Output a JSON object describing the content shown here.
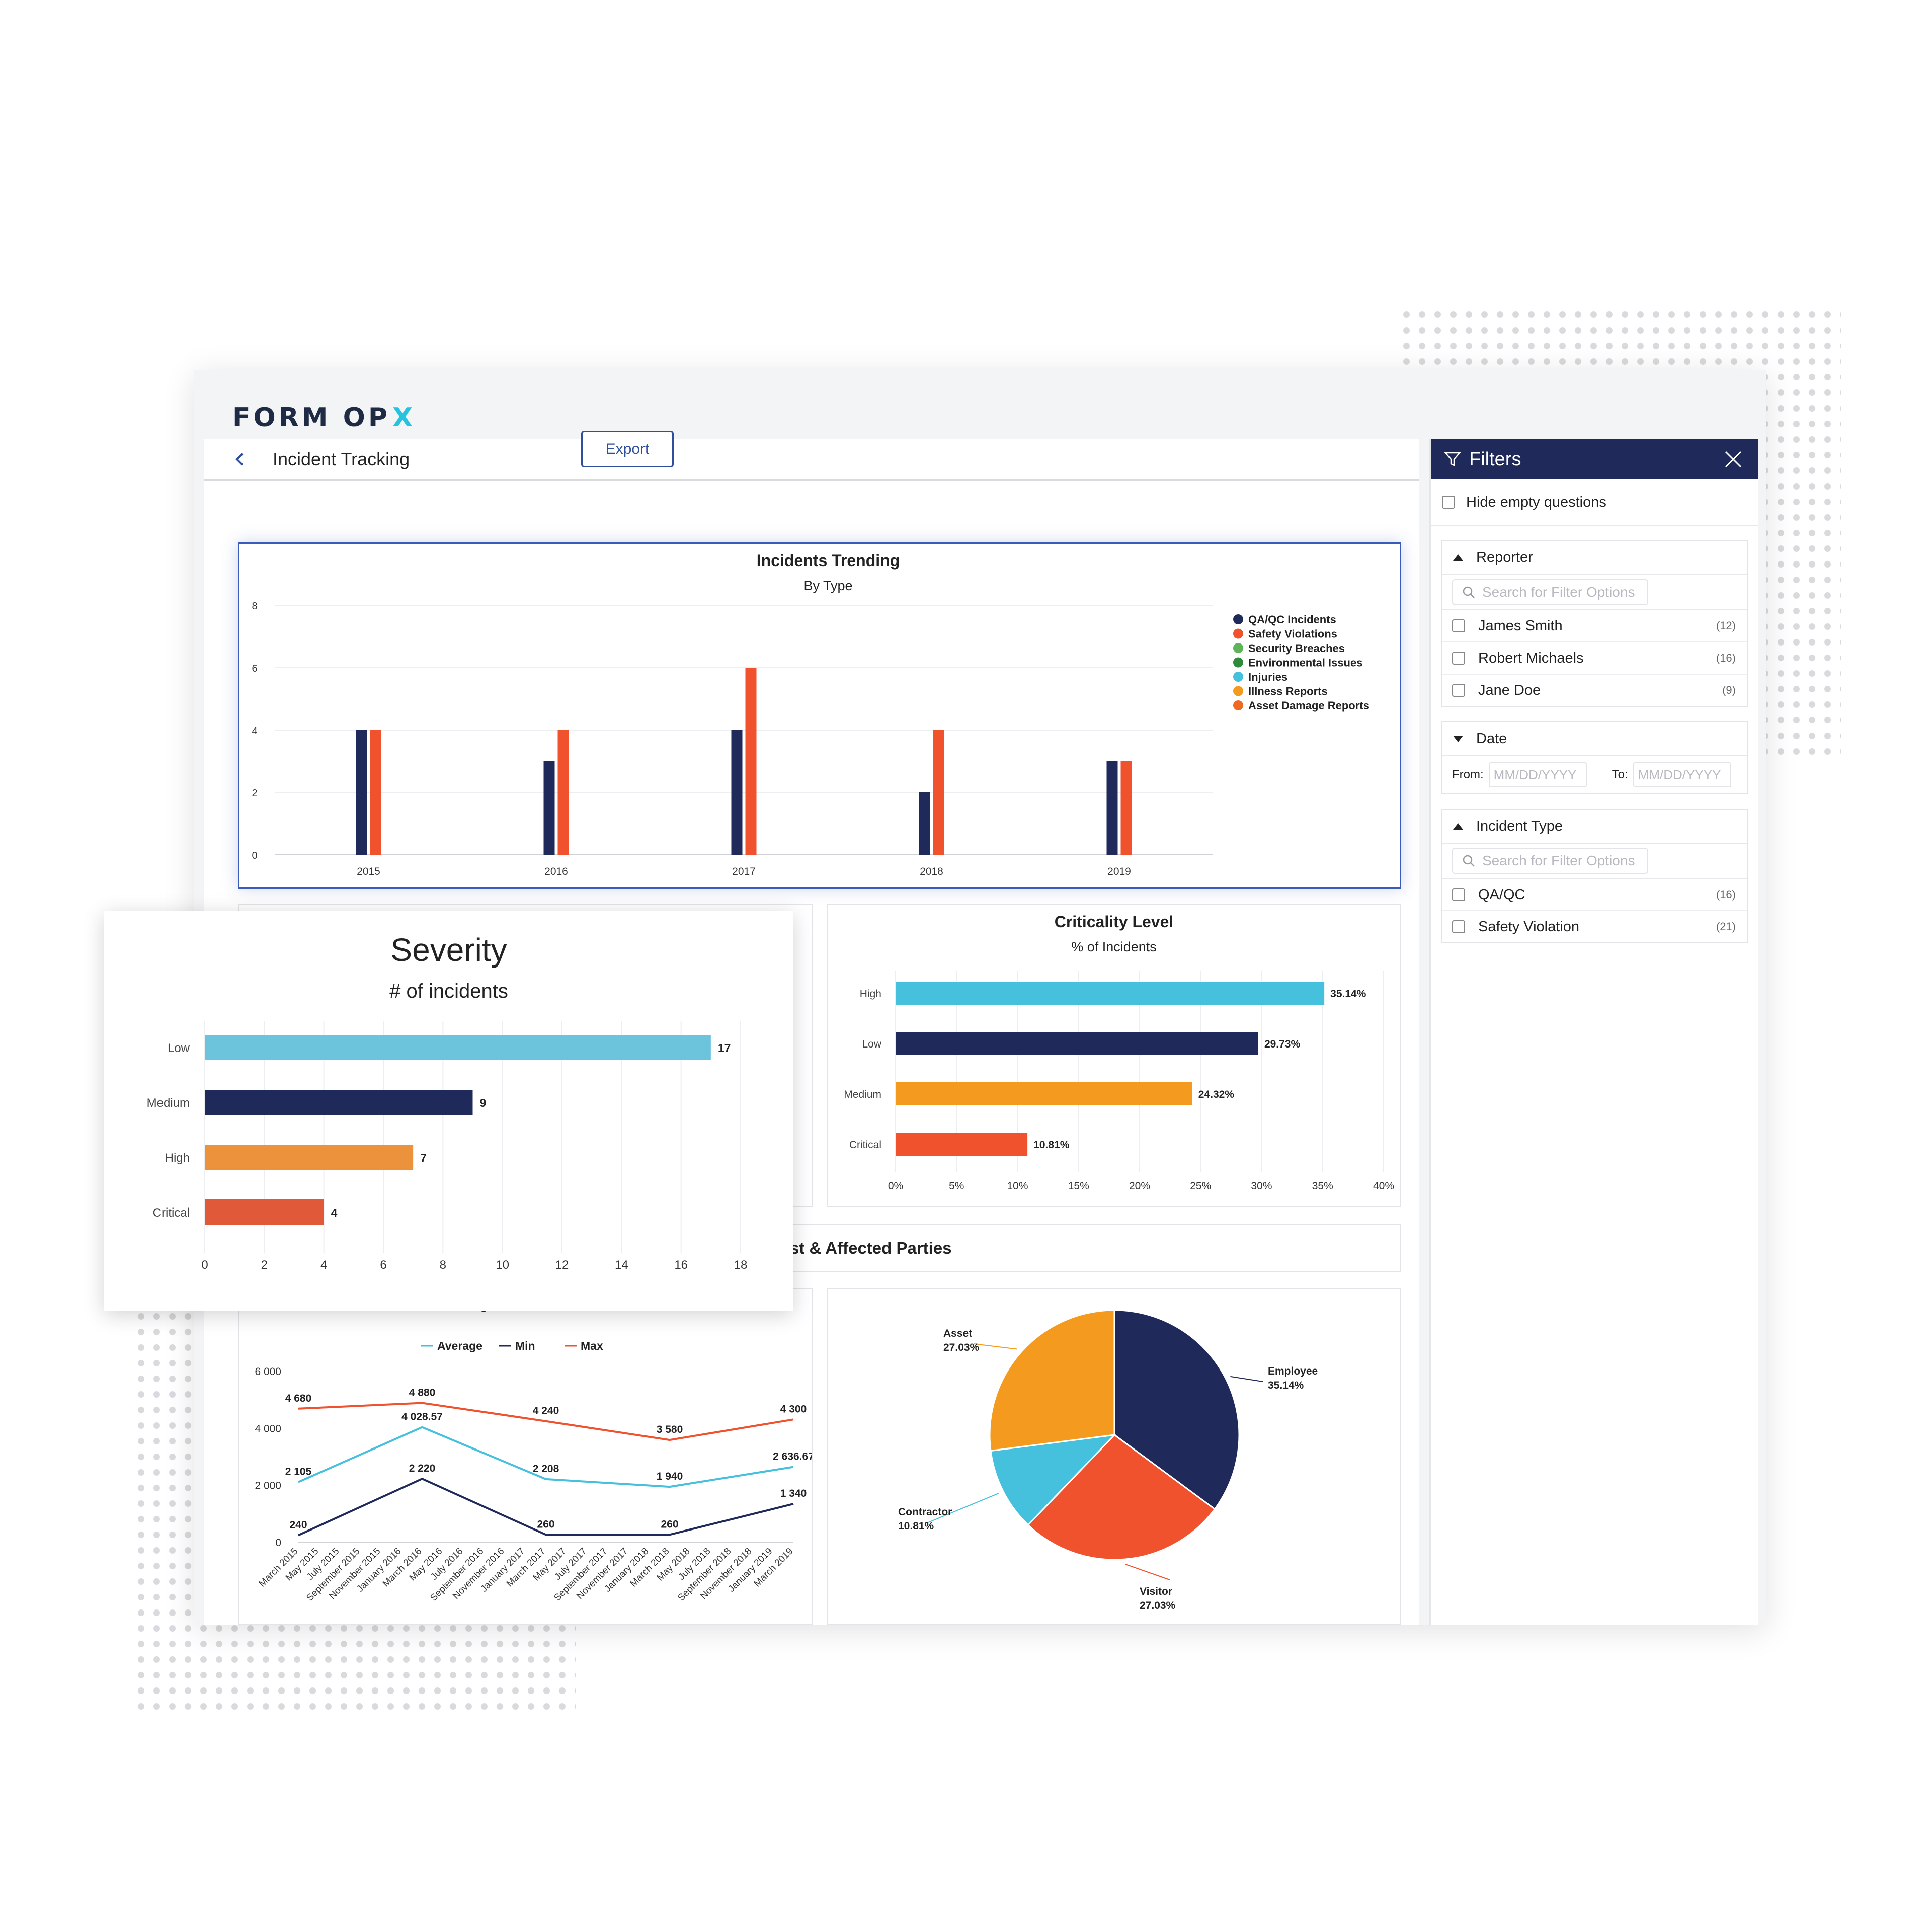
{
  "brand": {
    "name": "FORM OP",
    "mark": "X"
  },
  "header": {
    "title": "Incident Tracking"
  },
  "toolbar": {
    "export_label": "Export"
  },
  "filters": {
    "title": "Filters",
    "hide_empty": "Hide empty questions",
    "reporter": {
      "label": "Reporter",
      "search_placeholder": "Search for Filter Options",
      "options": [
        {
          "name": "James Smith",
          "count": "(12)"
        },
        {
          "name": "Robert Michaels",
          "count": "(16)"
        },
        {
          "name": "Jane Doe",
          "count": "(9)"
        }
      ]
    },
    "date": {
      "label": "Date",
      "from_label": "From:",
      "to_label": "To:",
      "from_placeholder": "MM/DD/YYYY",
      "to_placeholder": "MM/DD/YYYY"
    },
    "incident_type": {
      "label": "Incident Type",
      "search_placeholder": "Search for Filter Options",
      "options": [
        {
          "name": "QA/QC",
          "count": "(16)"
        },
        {
          "name": "Safety Violation",
          "count": "(21)"
        }
      ]
    }
  },
  "chart_data": [
    {
      "id": "trending",
      "type": "bar",
      "title": "Incidents Trending",
      "subtitle": "By Type",
      "categories": [
        "2015",
        "2016",
        "2017",
        "2018",
        "2019"
      ],
      "ylim": [
        0,
        8
      ],
      "yticks": [
        "0",
        "2",
        "4",
        "6",
        "8"
      ],
      "legend_position": "right",
      "legend": [
        {
          "name": "QA/QC Incidents",
          "color": "#1f2a5a"
        },
        {
          "name": "Safety Violations",
          "color": "#f0522d"
        },
        {
          "name": "Security Breaches",
          "color": "#5fb35a"
        },
        {
          "name": "Environmental Issues",
          "color": "#2e8b3a"
        },
        {
          "name": "Injuries",
          "color": "#45c1de"
        },
        {
          "name": "Illness Reports",
          "color": "#f49a1e"
        },
        {
          "name": "Asset Damage Reports",
          "color": "#ee6a22"
        }
      ],
      "series": [
        {
          "name": "QA/QC Incidents",
          "color": "#1f2a5a",
          "values": [
            4,
            3,
            4,
            2,
            3
          ]
        },
        {
          "name": "Safety Violations",
          "color": "#f0522d",
          "values": [
            4,
            4,
            6,
            4,
            3
          ]
        }
      ],
      "grid": true
    },
    {
      "id": "criticality",
      "type": "bar",
      "orientation": "horizontal",
      "title": "Criticality Level",
      "subtitle": "% of Incidents",
      "categories": [
        "High",
        "Low",
        "Medium",
        "Critical"
      ],
      "values": [
        35.14,
        29.73,
        24.32,
        10.81
      ],
      "labels": [
        "35.14%",
        "29.73%",
        "24.32%",
        "10.81%"
      ],
      "colors": [
        "#45c1de",
        "#1f2a5a",
        "#f49a1e",
        "#f0522d"
      ],
      "xlim": [
        0,
        40
      ],
      "xticks": [
        "0%",
        "5%",
        "10%",
        "15%",
        "20%",
        "25%",
        "30%",
        "35%",
        "40%"
      ],
      "grid": true
    },
    {
      "id": "severity",
      "type": "bar",
      "orientation": "horizontal",
      "title": "Severity",
      "subtitle": "# of incidents",
      "categories": [
        "Low",
        "Medium",
        "High",
        "Critical"
      ],
      "values": [
        17,
        9,
        7,
        4
      ],
      "labels": [
        "17",
        "9",
        "7",
        "4"
      ],
      "colors": [
        "#6cc3dc",
        "#1f2a5a",
        "#ec923c",
        "#e05a3a"
      ],
      "xlim": [
        0,
        18
      ],
      "xticks": [
        "0",
        "2",
        "4",
        "6",
        "8",
        "10",
        "12",
        "14",
        "16",
        "18"
      ],
      "grid": true
    },
    {
      "id": "remediation",
      "type": "line",
      "title": "Average Remediation Cost",
      "x": [
        "March 2015",
        "May 2015",
        "July 2015",
        "September 2015",
        "November 2015",
        "January 2016",
        "March 2016",
        "May 2016",
        "July 2016",
        "September 2016",
        "November 2016",
        "January 2017",
        "March 2017",
        "May 2017",
        "July 2017",
        "September 2017",
        "November 2017",
        "January 2018",
        "March 2018",
        "May 2018",
        "July 2018",
        "September 2018",
        "November 2018",
        "January 2019",
        "March 2019"
      ],
      "ylim": [
        0,
        6000
      ],
      "yticks": [
        "0",
        "2 000",
        "4 000",
        "6 000"
      ],
      "legend_position": "top",
      "series": [
        {
          "name": "Average",
          "color": "#45c1de",
          "values": [
            2105,
            2600,
            3100,
            3560,
            4028.57,
            3500,
            2900,
            2208,
            2150,
            2080,
            2000,
            1960,
            1940,
            2100,
            2300,
            2636.67
          ],
          "points": [
            [
              0,
              2105
            ],
            [
              6,
              4028.57
            ],
            [
              12,
              2208
            ],
            [
              18,
              1940
            ],
            [
              24,
              2636.67
            ]
          ],
          "labels": [
            {
              "i": 0,
              "text": "2 105"
            },
            {
              "i": 6,
              "text": "4 028.57"
            },
            {
              "i": 12,
              "text": "2 208"
            },
            {
              "i": 18,
              "text": "1 940"
            },
            {
              "i": 24,
              "text": "2 636.67"
            }
          ]
        },
        {
          "name": "Min",
          "color": "#1f2a5a",
          "points": [
            [
              0,
              240
            ],
            [
              6,
              2220
            ],
            [
              12,
              260
            ],
            [
              18,
              260
            ],
            [
              24,
              1340
            ]
          ],
          "labels": [
            {
              "i": 0,
              "text": "240"
            },
            {
              "i": 6,
              "text": "2 220"
            },
            {
              "i": 12,
              "text": "260"
            },
            {
              "i": 18,
              "text": "260"
            },
            {
              "i": 24,
              "text": "1 340"
            }
          ]
        },
        {
          "name": "Max",
          "color": "#f0522d",
          "points": [
            [
              0,
              4680
            ],
            [
              6,
              4880
            ],
            [
              12,
              4240
            ],
            [
              18,
              3580
            ],
            [
              24,
              4300
            ]
          ],
          "labels": [
            {
              "i": 0,
              "text": "4 680"
            },
            {
              "i": 6,
              "text": "4 880"
            },
            {
              "i": 12,
              "text": "4 240"
            },
            {
              "i": 18,
              "text": "3 580"
            },
            {
              "i": 24,
              "text": "4 300"
            }
          ]
        }
      ]
    },
    {
      "id": "affected",
      "type": "pie",
      "title": "st & Affected Parties",
      "slices": [
        {
          "name": "Employee",
          "value": 35.14,
          "label": "35.14%",
          "color": "#1f2a5a"
        },
        {
          "name": "Visitor",
          "value": 27.03,
          "label": "27.03%",
          "color": "#f0522d"
        },
        {
          "name": "Contractor",
          "value": 10.81,
          "label": "10.81%",
          "color": "#45c1de"
        },
        {
          "name": "Asset",
          "value": 27.03,
          "label": "27.03%",
          "color": "#f49a1e"
        }
      ]
    }
  ]
}
